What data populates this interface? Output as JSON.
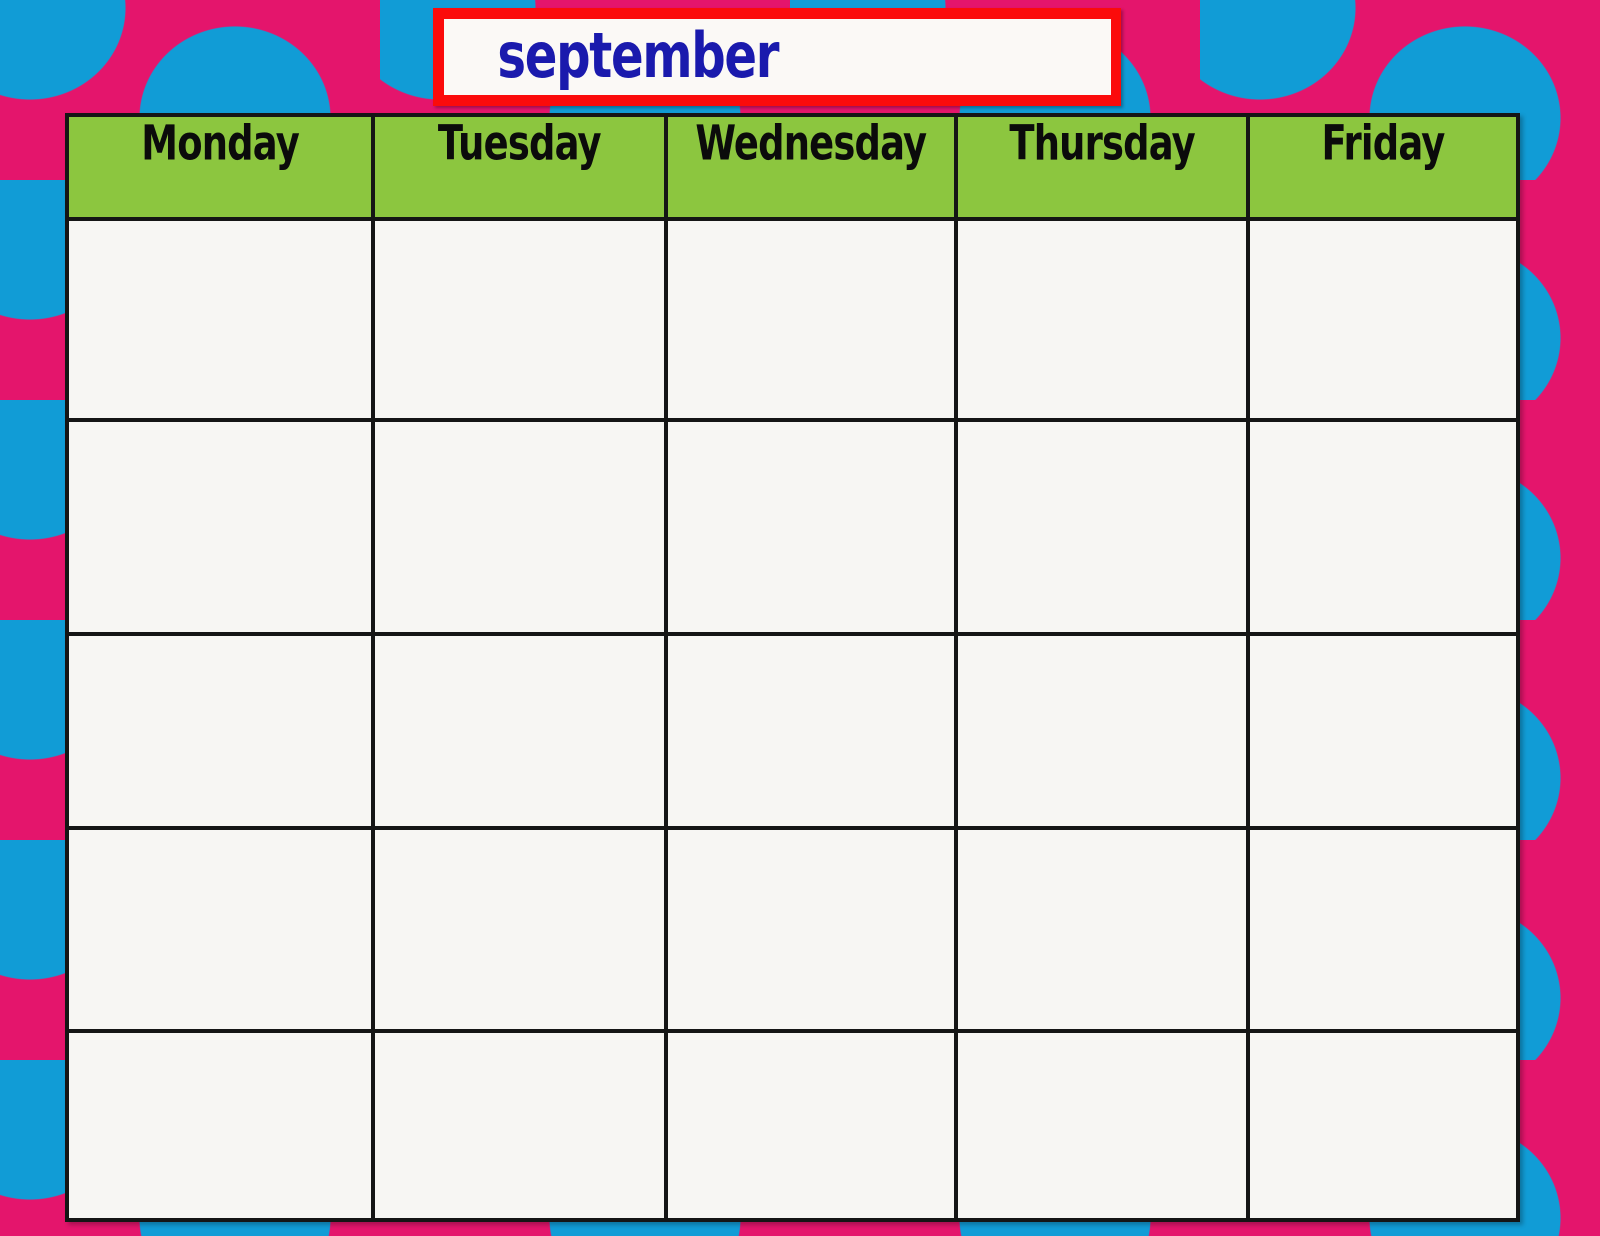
{
  "document": {
    "type": "blank-monthly-calendar-template",
    "title": "september"
  },
  "background": {
    "name": "polka-dot-pattern",
    "base_color": "#e4156c",
    "dot_color": "#119cd6"
  },
  "title_plaque": {
    "text": "september",
    "text_color": "#1a1aad",
    "border_color": "#fb0b0b",
    "fill_color": "#fbf9f6"
  },
  "calendar": {
    "header_background": "#8cc63f",
    "cell_background": "#f7f6f3",
    "grid_line_color": "#151515",
    "columns": [
      {
        "label": "Monday"
      },
      {
        "label": "Tuesday"
      },
      {
        "label": "Wednesday"
      },
      {
        "label": "Thursday"
      },
      {
        "label": "Friday"
      }
    ],
    "rows": [
      {
        "cells": [
          "",
          "",
          "",
          "",
          ""
        ]
      },
      {
        "cells": [
          "",
          "",
          "",
          "",
          ""
        ]
      },
      {
        "cells": [
          "",
          "",
          "",
          "",
          ""
        ]
      },
      {
        "cells": [
          "",
          "",
          "",
          "",
          ""
        ]
      },
      {
        "cells": [
          "",
          "",
          "",
          "",
          ""
        ]
      }
    ]
  }
}
